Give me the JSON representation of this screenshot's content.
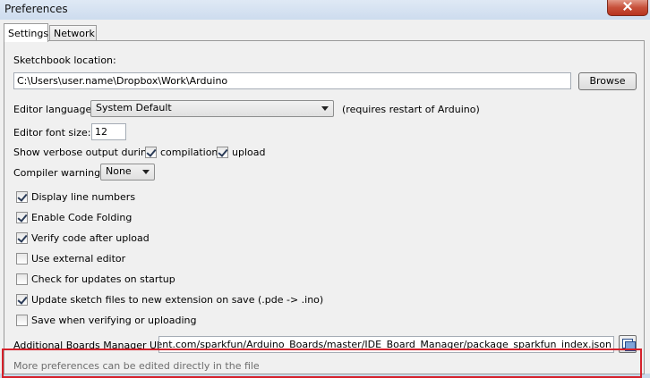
{
  "window": {
    "title": "Preferences",
    "close_icon": "close-icon"
  },
  "tabs": [
    {
      "label": "Settings",
      "active": true
    },
    {
      "label": "Network",
      "active": false
    }
  ],
  "sketchbook": {
    "label": "Sketchbook location:",
    "value": "C:\\Users\\user.name\\Dropbox\\Work\\Arduino",
    "browse_label": "Browse"
  },
  "editor_language": {
    "label": "Editor language:",
    "selected": "System Default",
    "note": "(requires restart of Arduino)"
  },
  "font_size": {
    "label": "Editor font size:",
    "value": "12"
  },
  "verbose": {
    "label": "Show verbose output during:",
    "compilation_label": "compilation",
    "compilation_checked": true,
    "upload_label": "upload",
    "upload_checked": true
  },
  "compiler_warnings": {
    "label": "Compiler warnings:",
    "selected": "None"
  },
  "checkboxes": [
    {
      "label": "Display line numbers",
      "checked": true
    },
    {
      "label": "Enable Code Folding",
      "checked": true
    },
    {
      "label": "Verify code after upload",
      "checked": true
    },
    {
      "label": "Use external editor",
      "checked": false
    },
    {
      "label": "Check for updates on startup",
      "checked": false
    },
    {
      "label": "Update sketch files to new extension on save (.pde -> .ino)",
      "checked": true
    },
    {
      "label": "Save when verifying or uploading",
      "checked": false
    }
  ],
  "board_urls": {
    "label": "Additional Boards Manager URLs:",
    "value": "usercontent.com/sparkfun/Arduino_Boards/master/IDE_Board_Manager/package_sparkfun_index.json",
    "editor_icon": "multi-window-icon"
  },
  "footer": {
    "note": "More preferences can be edited directly in the file"
  },
  "colors": {
    "highlight": "#d6202a",
    "close_button": "#c7503a"
  }
}
